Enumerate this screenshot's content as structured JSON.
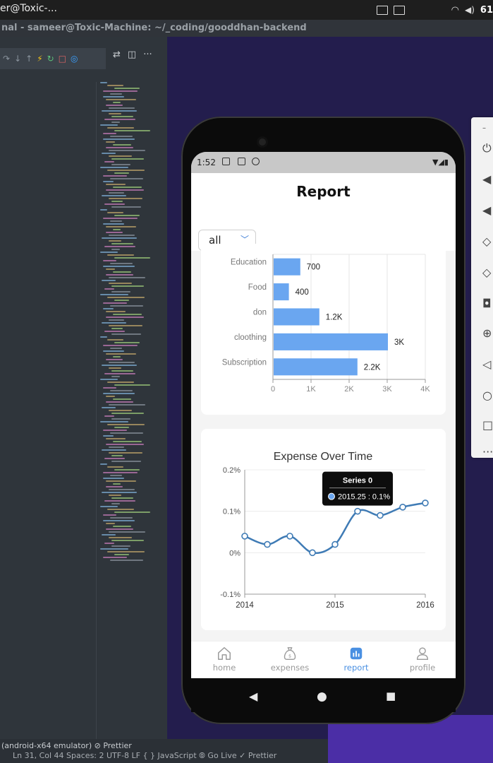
{
  "desktop": {
    "window_title": "er@Toxic-...",
    "terminal_title": "nal - sameer@Toxic-Machine: ~/_coding/gooddhan-backend",
    "clock": "61",
    "statusbar_row1": "(android-x64 emulator)  ⊘ Prettier",
    "statusbar_row2": "Ln 31, Col 44   Spaces: 2   UTF-8   LF   { } JavaScript   ⦾ Go Live   ✓ Prettier"
  },
  "app": {
    "status_time": "1:52",
    "page_title": "Report",
    "filter": {
      "selected": "all"
    },
    "tabs": [
      {
        "label": "home",
        "icon": "home-icon",
        "active": false
      },
      {
        "label": "expenses",
        "icon": "money-bag-icon",
        "active": false
      },
      {
        "label": "report",
        "icon": "bar-chart-icon",
        "active": true
      },
      {
        "label": "profile",
        "icon": "user-icon",
        "active": false
      }
    ]
  },
  "chart_data": [
    {
      "type": "bar",
      "orientation": "horizontal",
      "categories": [
        "Education",
        "Food",
        "don",
        "cloothing",
        "Subscription"
      ],
      "values": [
        700,
        400,
        1200,
        3000,
        2200
      ],
      "data_labels": [
        "700",
        "400",
        "1.2K",
        "3K",
        "2.2K"
      ],
      "xlim": [
        0,
        4000
      ],
      "x_ticks": [
        "0",
        "1K",
        "2K",
        "3K",
        "4K"
      ],
      "color": "#6aa6f0",
      "grid": true
    },
    {
      "type": "line",
      "title": "Expense Over Time",
      "series": [
        {
          "name": "Series 0",
          "x": [
            2014,
            2014.25,
            2014.5,
            2014.75,
            2015,
            2015.25,
            2015.5,
            2015.75,
            2016
          ],
          "y": [
            0.04,
            0.02,
            0.04,
            0.0,
            0.02,
            0.1,
            0.09,
            0.11,
            0.12
          ]
        }
      ],
      "xlim": [
        2014,
        2016
      ],
      "ylim": [
        -0.1,
        0.2
      ],
      "x_ticks": [
        "2014",
        "2015",
        "2016"
      ],
      "y_ticks": [
        "-0.1%",
        "0%",
        "0.1%",
        "0.2%"
      ],
      "tooltip": {
        "title": "Series 0",
        "text": "2015.25 : 0.1%"
      },
      "color": "#3f7bb5",
      "grid": true
    }
  ]
}
